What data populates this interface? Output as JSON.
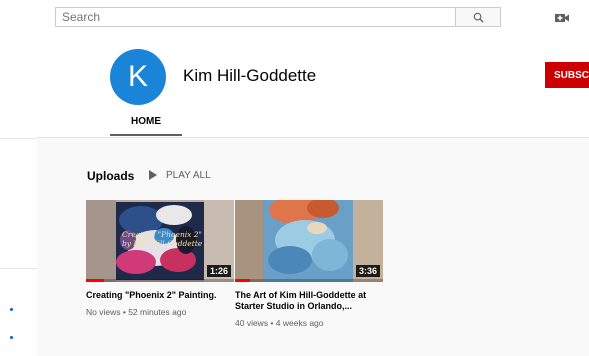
{
  "header": {
    "search_placeholder": "Search"
  },
  "channel": {
    "avatar_letter": "K",
    "name": "Kim Hill-Goddette",
    "subscribe_label": "SUBSCRIBE",
    "tabs": [
      {
        "label": "HOME",
        "selected": true
      }
    ]
  },
  "uploads": {
    "title": "Uploads",
    "play_all_label": "PLAY ALL",
    "videos": [
      {
        "title": "Creating \"Phoenix 2\" Painting.",
        "duration": "1:26",
        "views": "No views",
        "age": "52 minutes ago",
        "overlay_lines": [
          "Creating \"Phoenix 2\"",
          "by Kim Hill-Goddette"
        ],
        "watch_progress": 0.12
      },
      {
        "title": "The Art of Kim Hill-Goddette at Starter Studio in Orlando,...",
        "duration": "3:36",
        "views": "40 views",
        "age": "4 weeks ago",
        "watch_progress": 0.1
      }
    ]
  },
  "colors": {
    "subscribe": "#cc0000",
    "avatar": "#1a84d8",
    "progress": "#ff0000"
  }
}
